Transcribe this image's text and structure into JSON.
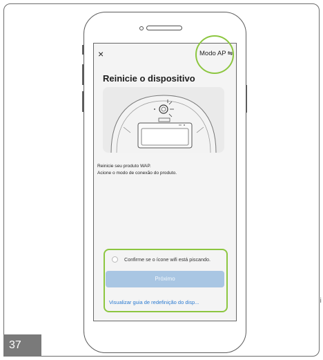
{
  "header": {
    "close_icon": "×",
    "mode_label": "Modo AP",
    "mode_icon": "⇋"
  },
  "main": {
    "title": "Reinicie o dispositivo",
    "description_line1": "Reinicie seu produto WAP.",
    "description_line2": "Acione o modo de conexão do produto."
  },
  "footer": {
    "confirm_label": "Confirme se o ícone wifi está piscando.",
    "next_button": "Próximo",
    "guide_link": "Visualizar guia de redefinição do disp..."
  },
  "page_number": "37",
  "colors": {
    "highlight": "#8cc63f",
    "button_bg": "#a9c6e3",
    "link": "#2a7ad1"
  }
}
